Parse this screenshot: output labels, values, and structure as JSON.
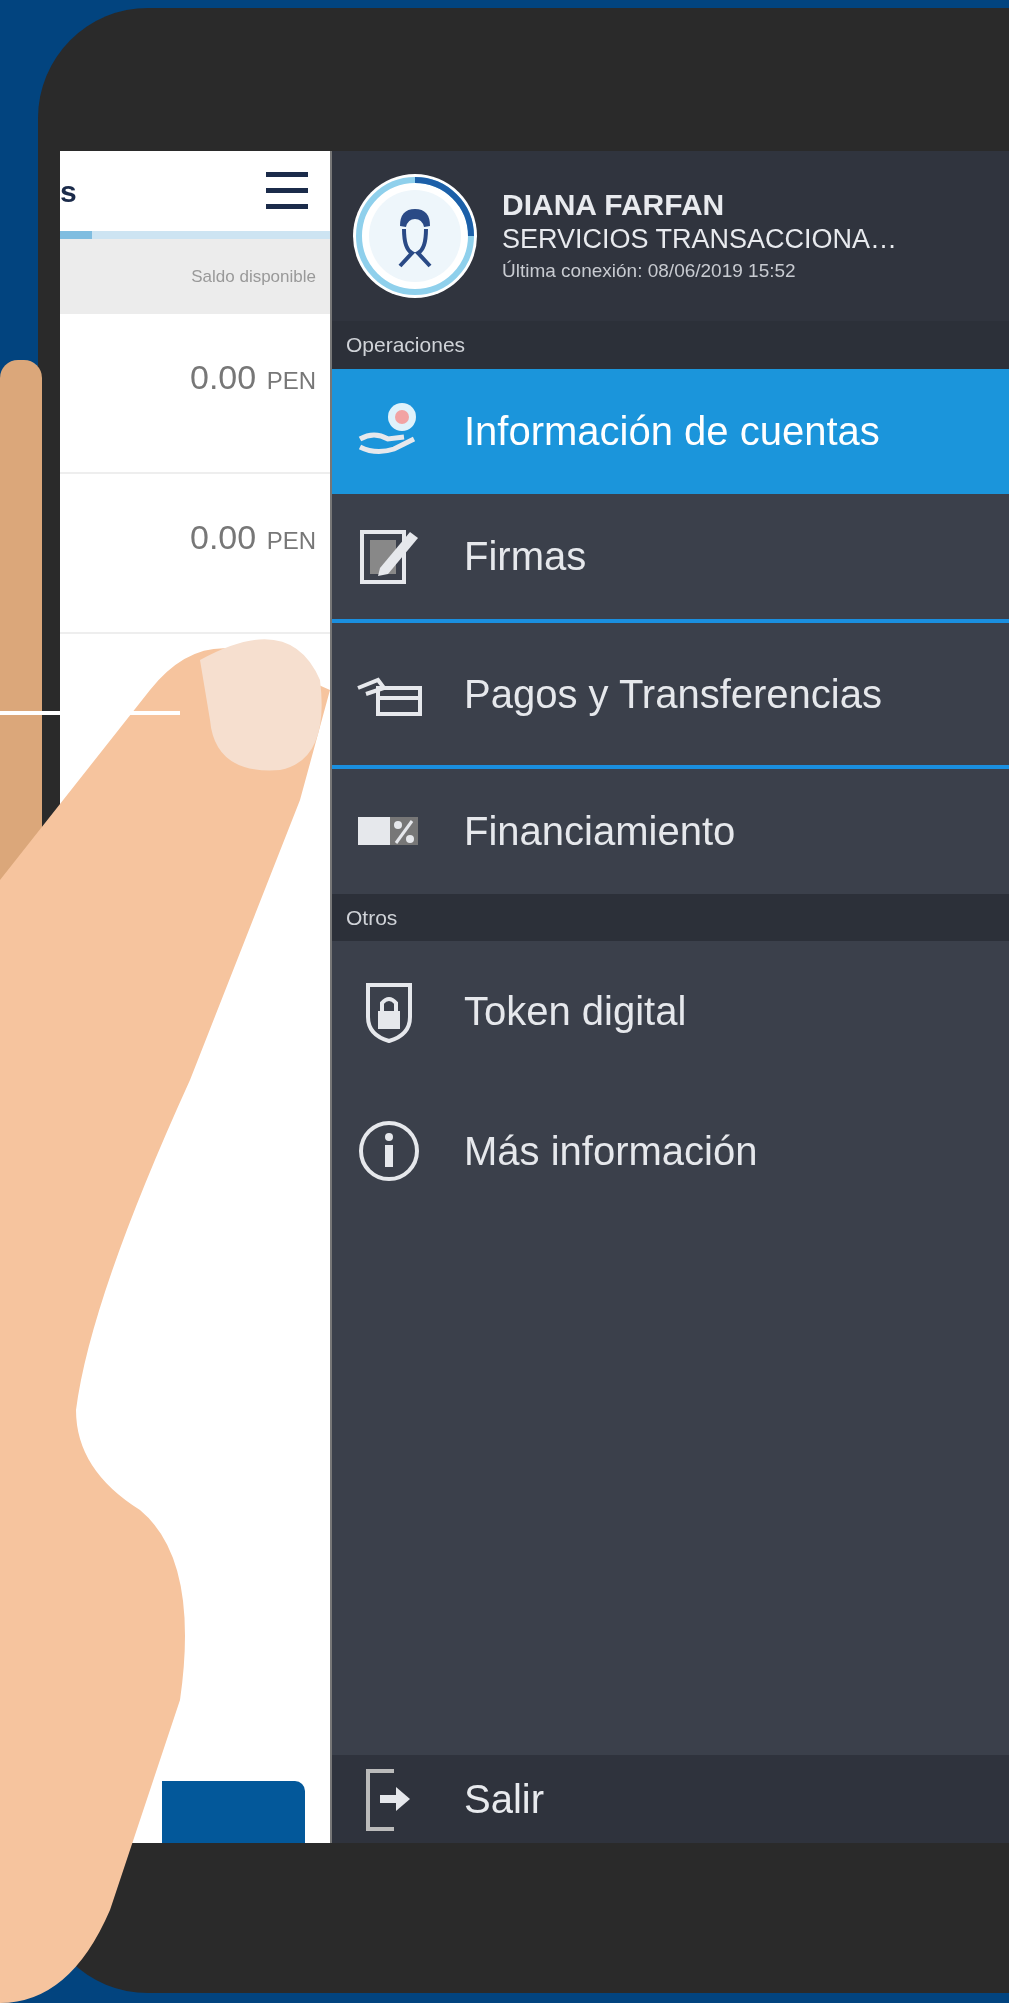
{
  "account_panel": {
    "title_fragment": "s",
    "column_header": "Saldo disponible",
    "rows": [
      {
        "amount": "0.00",
        "currency": "PEN"
      },
      {
        "amount": "0.00",
        "currency": "PEN"
      }
    ]
  },
  "menu": {
    "user": {
      "name": "DIANA FARFAN",
      "role": "SERVICIOS TRANSACCIONA…",
      "last_login": "Última conexión: 08/06/2019 15:52"
    },
    "sections": [
      {
        "title": "Operaciones",
        "items": [
          {
            "label": "Información de cuentas",
            "selected": true,
            "focused": false
          },
          {
            "label": "Firmas",
            "selected": false,
            "focused": false
          },
          {
            "label": "Pagos y Transferencias",
            "selected": false,
            "focused": true
          },
          {
            "label": "Financiamiento",
            "selected": false,
            "focused": false
          }
        ]
      },
      {
        "title": "Otros",
        "items": [
          {
            "label": "Token digital",
            "selected": false,
            "focused": false
          },
          {
            "label": "Más información",
            "selected": false,
            "focused": false
          }
        ]
      }
    ],
    "footer": {
      "label": "Salir"
    }
  }
}
